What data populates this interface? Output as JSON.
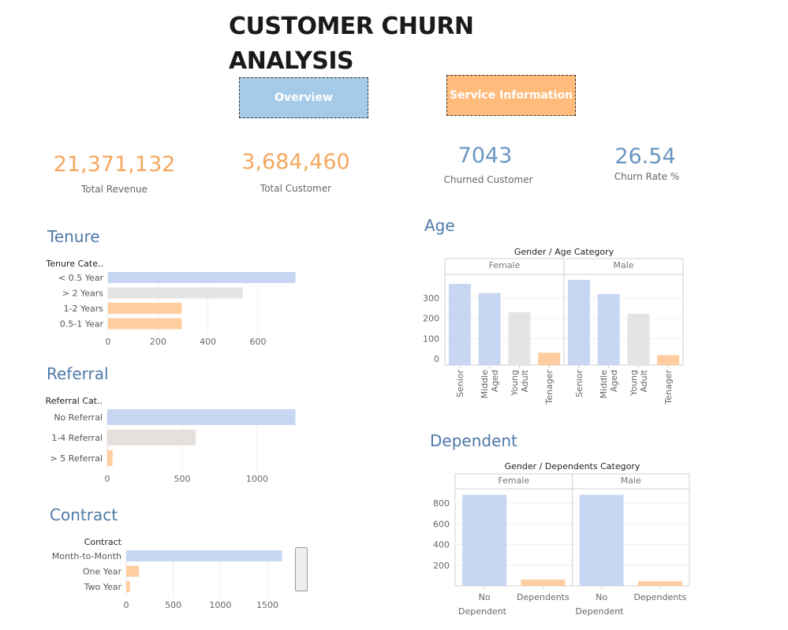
{
  "title": "CUSTOMER CHURN\nANALYSIS",
  "nav": {
    "overview": "Overview",
    "service": "Service Information"
  },
  "kpis": {
    "revenue": {
      "value": "21,371,132",
      "label": "Total Revenue"
    },
    "customers": {
      "value": "3,684,460",
      "label": "Total Customer"
    },
    "churned": {
      "value": "7043",
      "label": "Churned Customer"
    },
    "churn_rate": {
      "value": "26.54",
      "label": "Churn Rate %"
    }
  },
  "colors": {
    "blue": "#c6d6f3",
    "grey": "#e4e4e4",
    "warm_grey": "#e6e0dc",
    "orange": "#ffcda0",
    "kpi_orange": "#f5a860",
    "kpi_blue": "#6a96c3",
    "section": "#4e79a7"
  },
  "sections": {
    "tenure": "Tenure",
    "referral": "Referral",
    "contract": "Contract",
    "age": "Age",
    "dependent": "Dependent"
  },
  "chart_data": [
    {
      "type": "bar",
      "orientation": "horizontal",
      "field_label": "Tenure Cate..",
      "categories": [
        "< 0.5 Year",
        "> 2 Years",
        "1-2 Years",
        "0.5-1 Year"
      ],
      "values": [
        750,
        540,
        295,
        295
      ],
      "colors": [
        "blue",
        "grey",
        "orange",
        "orange"
      ],
      "xticks": [
        0,
        200,
        400,
        600
      ]
    },
    {
      "type": "bar",
      "orientation": "horizontal",
      "field_label": "Referral Cat..",
      "categories": [
        "No Referral",
        "1-4 Referral",
        "> 5 Referral"
      ],
      "values": [
        1255,
        590,
        35
      ],
      "colors": [
        "blue",
        "warm_grey",
        "orange"
      ],
      "xticks": [
        0,
        500,
        1000
      ]
    },
    {
      "type": "bar",
      "orientation": "horizontal",
      "field_label": "Contract",
      "categories": [
        "Month-to-Month",
        "One Year",
        "Two Year"
      ],
      "values": [
        1655,
        135,
        40
      ],
      "colors": [
        "blue",
        "orange",
        "orange"
      ],
      "xticks": [
        0,
        500,
        1000,
        1500
      ]
    },
    {
      "type": "bar",
      "orientation": "vertical",
      "title": "Gender / Age Category",
      "panels": [
        "Female",
        "Male"
      ],
      "categories": [
        "Senior",
        "Middle Aged",
        "Young Adult",
        "Tenager"
      ],
      "values": [
        [
          370,
          325,
          230,
          30
        ],
        [
          390,
          320,
          222,
          18
        ]
      ],
      "colors": [
        "blue",
        "blue",
        "grey",
        "orange"
      ],
      "yticks": [
        0,
        100,
        200,
        300
      ]
    },
    {
      "type": "bar",
      "orientation": "vertical",
      "title": "Gender / Dependents Category",
      "panels": [
        "Female",
        "Male"
      ],
      "categories": [
        "No Dependent",
        "Dependents"
      ],
      "values": [
        [
          880,
          60
        ],
        [
          880,
          45
        ]
      ],
      "colors": [
        "blue",
        "orange"
      ],
      "yticks": [
        200,
        400,
        600,
        800
      ]
    }
  ]
}
